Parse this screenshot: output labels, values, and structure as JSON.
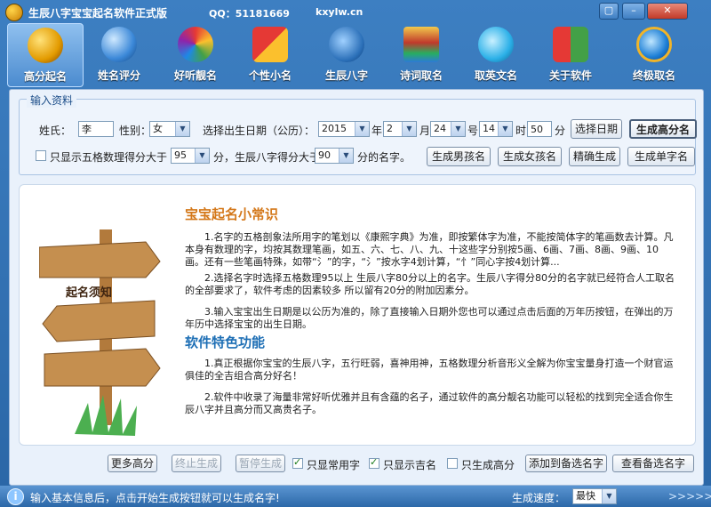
{
  "window": {
    "title": "生辰八字宝宝起名软件正式版",
    "qq": "QQ：51181669",
    "site": "kxylw.cn",
    "controls": {
      "menu": "▢",
      "minimize": "–",
      "close": "✕"
    }
  },
  "toolbar": [
    {
      "label": "高分起名",
      "icon": "taiji-icon",
      "active": true
    },
    {
      "label": "姓名评分",
      "icon": "globe-icon"
    },
    {
      "label": "好听靓名",
      "icon": "flower-icon"
    },
    {
      "label": "个性小名",
      "icon": "puzzle-icon"
    },
    {
      "label": "生辰八字",
      "icon": "horse-icon"
    },
    {
      "label": "诗词取名",
      "icon": "books-icon"
    },
    {
      "label": "取英文名",
      "icon": "browser-icon"
    },
    {
      "label": "关于软件",
      "icon": "windows-flag-icon"
    },
    {
      "label": "终极取名",
      "icon": "ie-globe-icon"
    }
  ],
  "form": {
    "legend": "输入资料",
    "surname_label": "姓氏：",
    "surname_value": "李",
    "gender_label": "性别：",
    "gender_value": "女",
    "date_label": "选择出生日期（公历）：",
    "year_value": "2015",
    "year_unit": "年",
    "month_value": "2",
    "month_unit": "月",
    "day_value": "24",
    "day_unit": "号",
    "hour_value": "14",
    "hour_unit": "时",
    "minute_value": "50",
    "minute_unit": "分",
    "pick_date_btn": "选择日期",
    "gen_high_btn": "生成高分名",
    "only_show_prefix": "只显示五格数理得分大于",
    "wuge_value": "95",
    "only_show_mid": "分，生辰八字得分大于",
    "bazi_value": "90",
    "only_show_suffix": "分的名字。",
    "boy_btn": "生成男孩名",
    "girl_btn": "生成女孩名",
    "exact_btn": "精确生成",
    "single_btn": "生成单字名"
  },
  "info": {
    "sign_text": "起名须知",
    "section1_title": "宝宝起名小常识",
    "p1": "1.名字的五格剖象法所用字的笔划以《康熙字典》为准，即按繁体字为准，不能按简体字的笔画数去计算。凡本身有数理的字，均按其数理笔画，如五、六、七、八、九、十这些字分别按5画、6画、7画、8画、9画、10画。还有一些笔画特殊，如带“氵”的字，“氵”按水字4划计算，“忄”同心字按4划计算...",
    "p2": "2.选择名字时选择五格数理95以上 生辰八字80分以上的名字。生辰八字得分80分的名字就已经符合人工取名的全部要求了，软件考虑的因素较多 所以留有20分的附加因素分。",
    "p3": "3.输入宝宝出生日期是以公历为准的，除了直接输入日期外您也可以通过点击后面的万年历按钮，在弹出的万年历中选择宝宝的出生日期。",
    "section2_title": "软件特色功能",
    "p4": "1.真正根据你宝宝的生辰八字，五行旺弱，喜神用神，五格数理分析音形义全解为你宝宝量身打造一个财官运俱佳的全吉组合高分好名！",
    "p5": "2.软件中收录了海量非常好听优雅并且有含蕴的名子，通过软件的高分靓名功能可以轻松的找到完全适合你生辰八字并且高分而又高贵名子。"
  },
  "actions": {
    "more_btn": "更多高分",
    "stop_btn": "终止生成",
    "pause_btn": "暂停生成",
    "common_chk": "只显常用字",
    "lucky_chk": "只显示吉名",
    "high_chk": "只生成高分",
    "add_btn": "添加到备选名字",
    "view_btn": "查看备选名字"
  },
  "status": {
    "message": "输入基本信息后，点击开始生成按钮就可以生成名字!",
    "speed_label": "生成速度：",
    "speed_value": "最快",
    "arrows": ">>>>>"
  },
  "colors": {
    "accent": "#2e6aa8",
    "heading_orange": "#d4781a",
    "heading_blue": "#1e6fb5"
  }
}
